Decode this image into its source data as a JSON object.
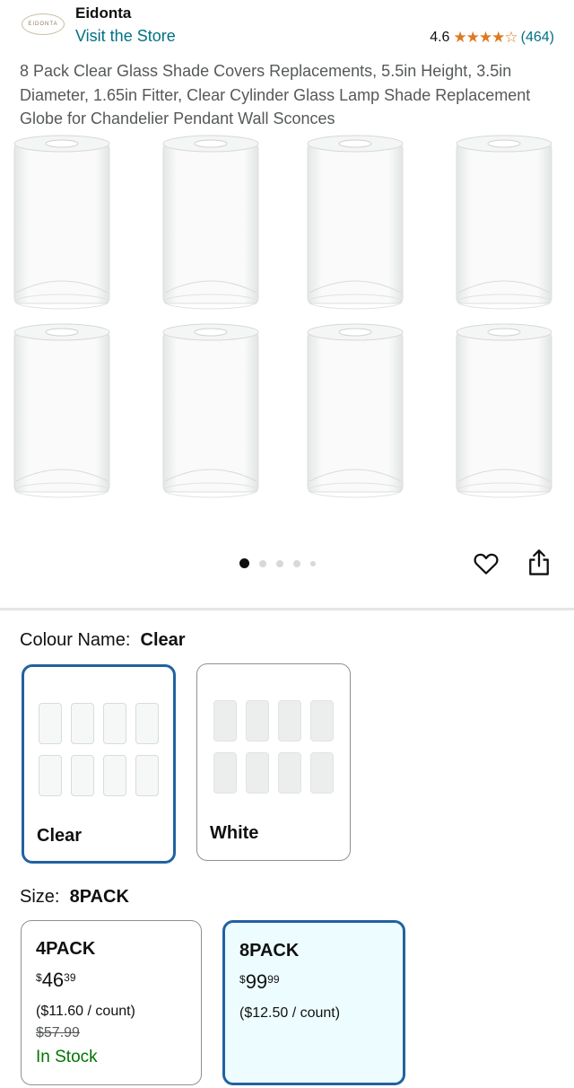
{
  "store": {
    "logo_text": "EIDONTA",
    "brand": "Eidonta",
    "visit": "Visit the Store",
    "rating": "4.6",
    "stars": "★★★★☆",
    "rating_value": 4.6,
    "review_count": "(464)"
  },
  "product": {
    "title": "8 Pack Clear Glass Shade Covers Replacements, 5.5in Height, 3.5in Diameter, 1.65in Fitter, Clear Cylinder Glass Lamp Shade Replacement Globe for Chandelier Pendant Wall Sconces"
  },
  "gallery": {
    "image_count": 5,
    "active_index": 0,
    "icons": [
      "heart-icon",
      "share-icon"
    ]
  },
  "colour": {
    "label": "Colour Name:",
    "selected": "Clear",
    "options": [
      {
        "label": "Clear",
        "selected": true
      },
      {
        "label": "White",
        "selected": false
      }
    ]
  },
  "size": {
    "label": "Size:",
    "selected": "8PACK",
    "options": [
      {
        "name": "4PACK",
        "currency": "$",
        "whole": "46",
        "fraction": "39",
        "per_count": "($11.60 / count)",
        "was": "$57.99",
        "stock": "In Stock",
        "selected": false
      },
      {
        "name": "8PACK",
        "currency": "$",
        "whole": "99",
        "fraction": "99",
        "per_count": "($12.50 / count)",
        "selected": true
      }
    ]
  },
  "colors": {
    "link": "#007185",
    "star": "#de7921",
    "selected_border": "#2162a1",
    "in_stock": "#007600"
  }
}
